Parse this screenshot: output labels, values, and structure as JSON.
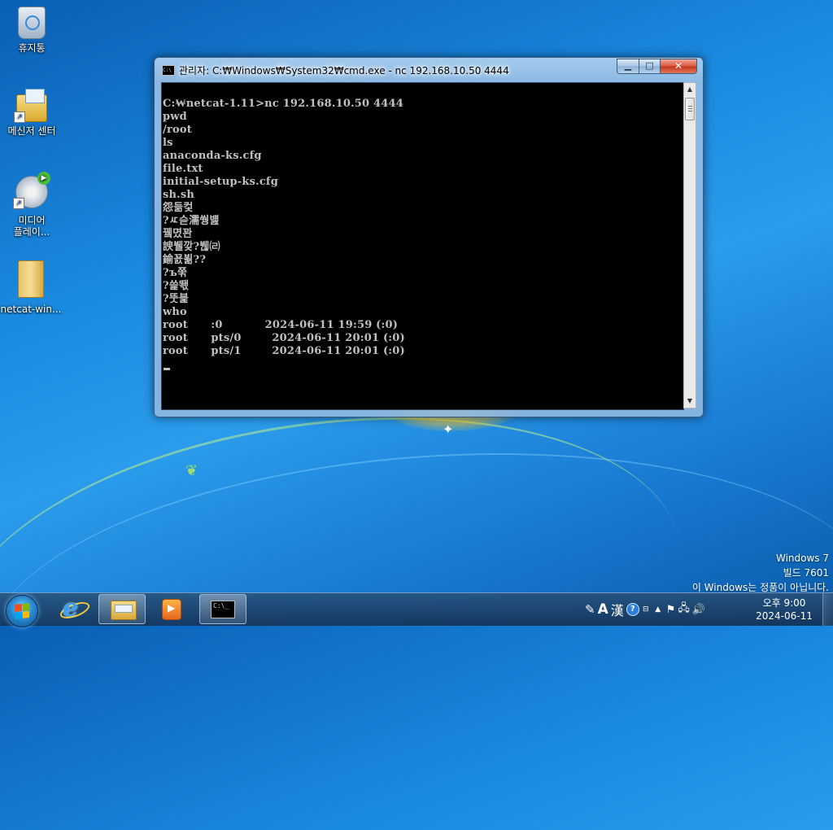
{
  "desktop": {
    "icons": [
      {
        "label": "휴지통",
        "icon": "recycle-bin-icon"
      },
      {
        "label": "메신저 센터",
        "icon": "messenger-icon"
      },
      {
        "label": "미디어\n플레이...",
        "line1": "미디어",
        "line2": "플레이...",
        "icon": "media-player-icon"
      },
      {
        "label": "netcat-win...",
        "icon": "folder-icon"
      }
    ],
    "watermark": {
      "line1": "Windows 7",
      "line2": "빌드 7601",
      "line3": "이 Windows는 정품이 아닙니다."
    }
  },
  "window": {
    "title": "관리자: C:₩Windows₩System32₩cmd.exe - nc  192.168.10.50 4444",
    "icon_label": "C:\\",
    "buttons": {
      "minimize": "▁",
      "maximize": "□",
      "close": "✕"
    },
    "console_lines": [
      "C:₩netcat-1.11>nc 192.168.10.50 4444",
      "pwd",
      "/root",
      "ls",
      "anaconda-ks.cfg",
      "file.txt",
      "initial-setup-ks.cfg",
      "sh.sh",
      "怨듦컻",
      "?ㅼ슫濡쒕뱶",
      "뀈몄꽌",
      "諛뷀깢?붾㈃",
      "鍮꾨뵒??",
      "?ъ쭊",
      "?쓽뙋",
      "?뚯븙",
      "who",
      "root      :0           2024-06-11 19:59 (:0)",
      "root      pts/0        2024-06-11 20:01 (:0)",
      "root      pts/1        2024-06-11 20:01 (:0)"
    ]
  },
  "taskbar": {
    "items": [
      {
        "name": "internet-explorer",
        "icon": "ie-icon"
      },
      {
        "name": "windows-explorer",
        "icon": "folder-icon"
      },
      {
        "name": "media-player",
        "icon": "media-player-icon"
      },
      {
        "name": "command-prompt",
        "icon": "cmd-icon",
        "label": "C:\\_",
        "active": true
      }
    ],
    "tray": {
      "ime_mode": "A",
      "ime_hanja": "漢",
      "help": "?",
      "overflow": "▲"
    },
    "clock": {
      "time": "오후 9:00",
      "date": "2024-06-11"
    }
  },
  "colors": {
    "console_bg": "#000000",
    "console_fg": "#c0c0c0",
    "desktop_blue": "#1a8ae0",
    "close_red": "#c23719"
  }
}
